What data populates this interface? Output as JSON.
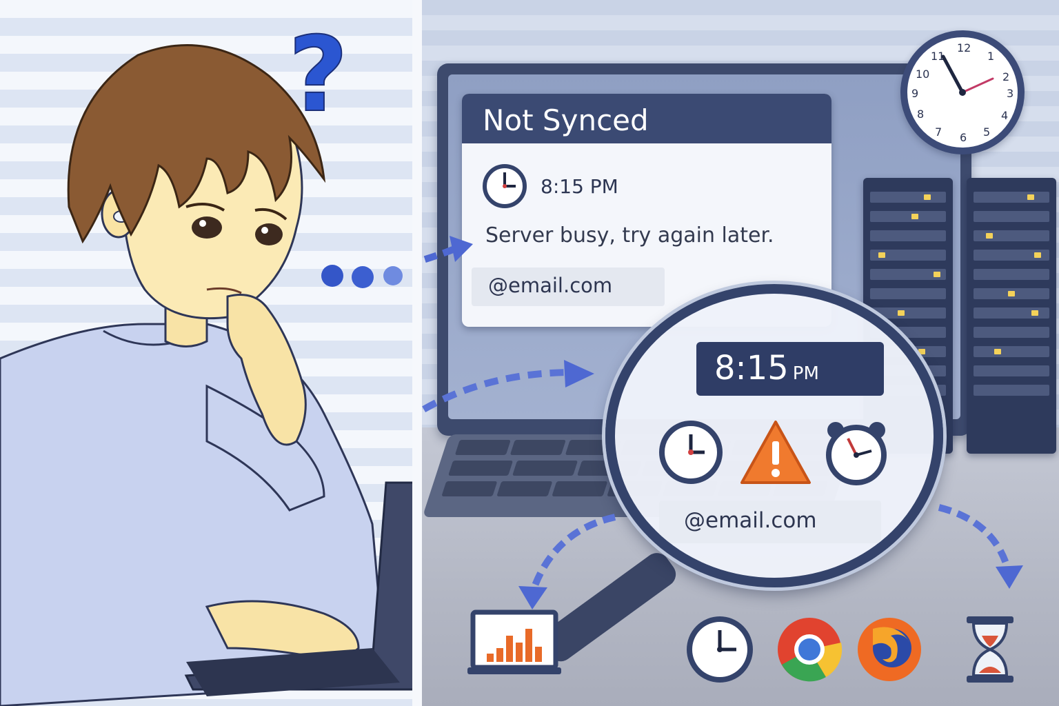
{
  "screen": {
    "title": "Not Synced",
    "time": "8:15 PM",
    "message": "Server busy, try again later.",
    "email": "@email.com"
  },
  "magnifier": {
    "time_hours": "8",
    "time_sep": ":",
    "time_minutes": "15",
    "time_period": "PM",
    "email": "@email.com",
    "icons": [
      "clock-icon",
      "warning-icon",
      "alarm-clock-icon"
    ]
  },
  "bottom_icons": [
    "laptop-chart-icon",
    "clock-icon",
    "chrome-icon",
    "firefox-icon",
    "hourglass-icon"
  ],
  "wall_clock": {
    "numbers": [
      "12",
      "1",
      "2",
      "3",
      "4",
      "5",
      "6",
      "7",
      "8",
      "9",
      "10",
      "11"
    ]
  },
  "colors": {
    "accent": "#3b4a73",
    "arrow": "#4e68d2",
    "warning": "#f07a2e",
    "question": "#2b56d1"
  }
}
